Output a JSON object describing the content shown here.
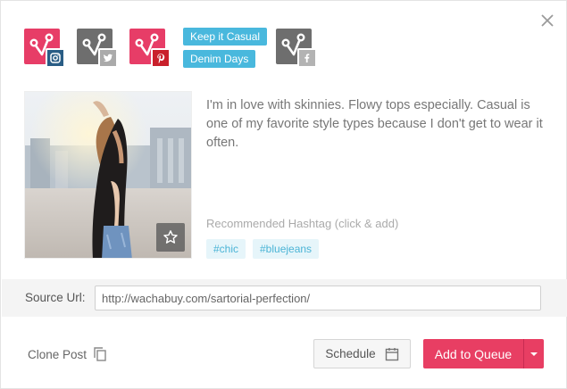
{
  "accounts": [
    {
      "network": "instagram",
      "color": "#e73d67",
      "badge_color": "#2a5d85",
      "icon": "instagram-icon"
    },
    {
      "network": "twitter",
      "color": "#6e6e6e",
      "badge_color": "#aaaaaa",
      "icon": "twitter-icon"
    },
    {
      "network": "pinterest",
      "color": "#e73d67",
      "badge_color": "#c9202b",
      "icon": "pinterest-icon"
    },
    {
      "network": "facebook",
      "color": "#6e6e6e",
      "badge_color": "#b3b3b3",
      "icon": "facebook-icon"
    }
  ],
  "board_tags": [
    "Keep it Casual",
    "Denim Days"
  ],
  "post": {
    "caption": "I'm in love with skinnies. Flowy tops especially. Casual is one of my favorite style types because I don't get to wear it often."
  },
  "hashtags": {
    "heading": "Recommended Hashtag (click & add)",
    "items": [
      "#chic",
      "#bluejeans"
    ]
  },
  "source": {
    "label": "Source Url:",
    "value": "http://wachabuy.com/sartorial-perfection/"
  },
  "footer": {
    "clone_label": "Clone Post",
    "schedule_label": "Schedule",
    "queue_label": "Add to Queue"
  },
  "colors": {
    "accent_pink": "#e83e63",
    "tag_blue": "#49b8dd",
    "hashtag_bg": "#e6f5fa"
  }
}
